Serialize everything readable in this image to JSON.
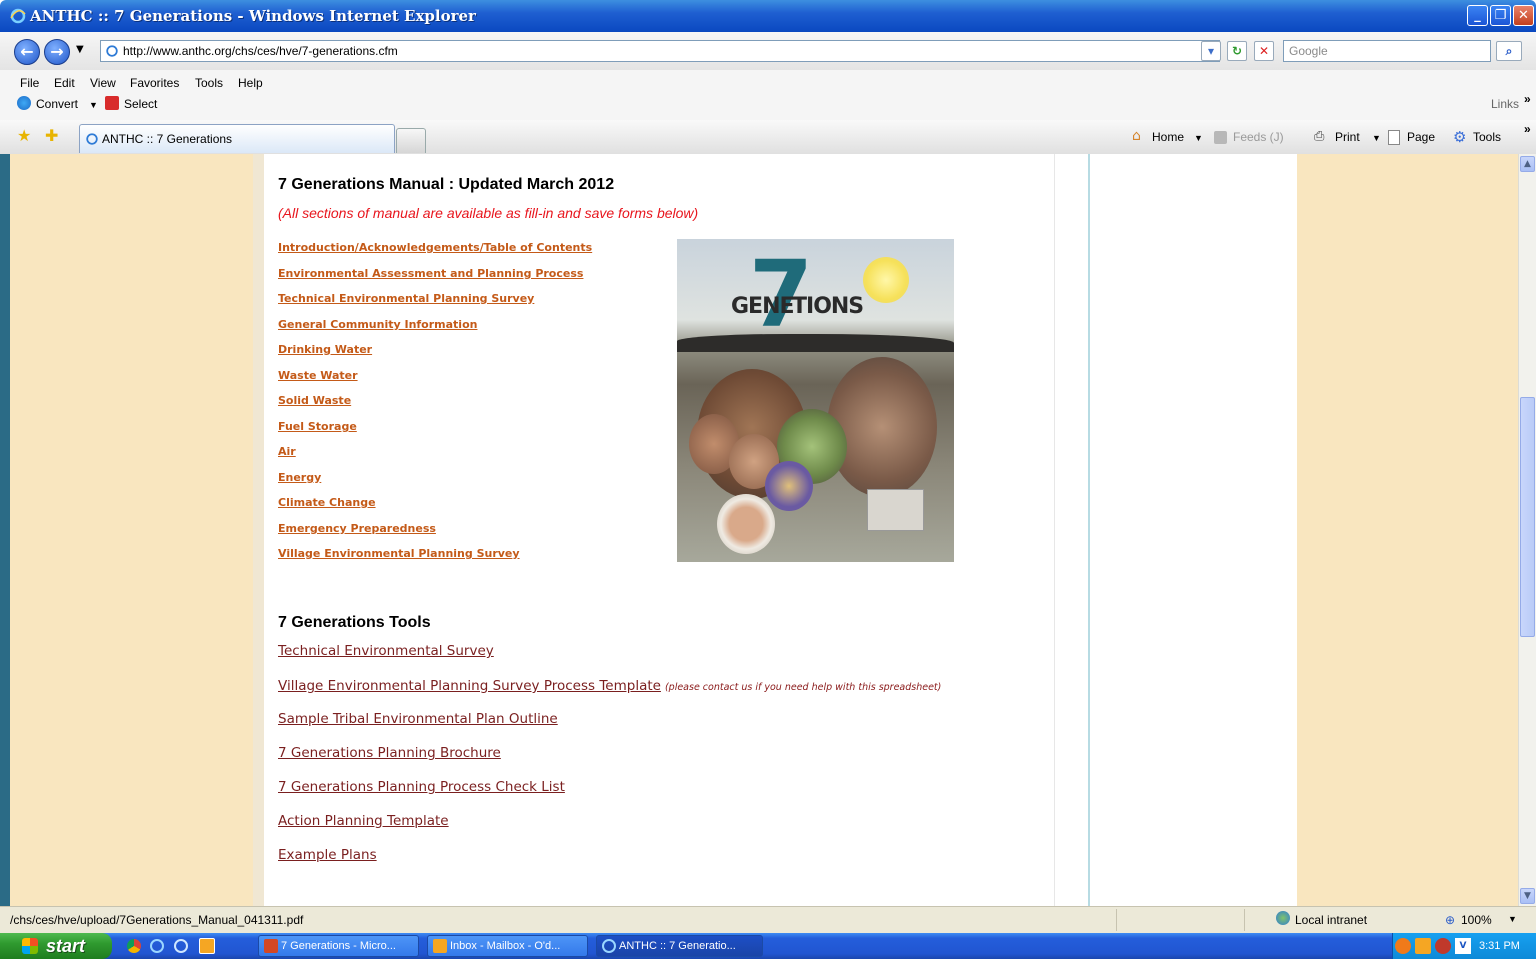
{
  "window": {
    "title": "ANTHC :: 7 Generations - Windows Internet Explorer"
  },
  "address": {
    "url": "http://www.anthc.org/chs/ces/hve/7-generations.cfm",
    "search_placeholder": "Google"
  },
  "menu": [
    "File",
    "Edit",
    "View",
    "Favorites",
    "Tools",
    "Help"
  ],
  "toolbar2": {
    "convert": "Convert",
    "select": "Select",
    "links": "Links"
  },
  "tab": {
    "title": "ANTHC :: 7 Generations"
  },
  "commands": {
    "home": "Home",
    "feeds": "Feeds (J)",
    "print": "Print",
    "page": "Page",
    "tools": "Tools"
  },
  "content": {
    "manual_heading": "7 Generations Manual : Updated March 2012",
    "manual_note": "(All sections of manual are available as fill-in and save forms below)",
    "manual_links": [
      "Introduction/Acknowledgements/Table of Contents",
      "Environmental Assessment and Planning Process",
      "Technical Environmental Planning Survey",
      "General Community Information",
      "Drinking Water",
      "Waste Water",
      "Solid Waste",
      "Fuel Storage",
      "Air",
      "Energy",
      "Climate Change",
      "Emergency Preparedness",
      "Village Environmental Planning Survey"
    ],
    "cover": {
      "numeral": "7",
      "title_left": "GENE",
      "title_right": "TIONS"
    },
    "tools_heading": "7 Generations Tools",
    "tools_links": [
      "Technical Environmental Survey",
      "Village Environmental Planning Survey Process Template",
      "Sample Tribal Environmental Plan Outline",
      "7 Generations Planning Brochure",
      "7 Generations Planning Process Check List",
      "Action Planning Template",
      "Example Plans"
    ],
    "tools_note": "(please contact us if you need help with this spreadsheet)"
  },
  "status": {
    "url": "/chs/ces/hve/upload/7Generations_Manual_041311.pdf",
    "zone": "Local intranet",
    "zoom": "100%"
  },
  "taskbar": {
    "start": "start",
    "tasks": [
      "7 Generations - Micro...",
      "Inbox - Mailbox - O'd...",
      "ANTHC :: 7 Generatio..."
    ],
    "time": "3:31 PM"
  },
  "colors": {
    "link_manual": "#c45a18",
    "link_tools": "#7a1f1f",
    "note_red": "#e8151d",
    "page_bg": "#f9e6bf"
  }
}
